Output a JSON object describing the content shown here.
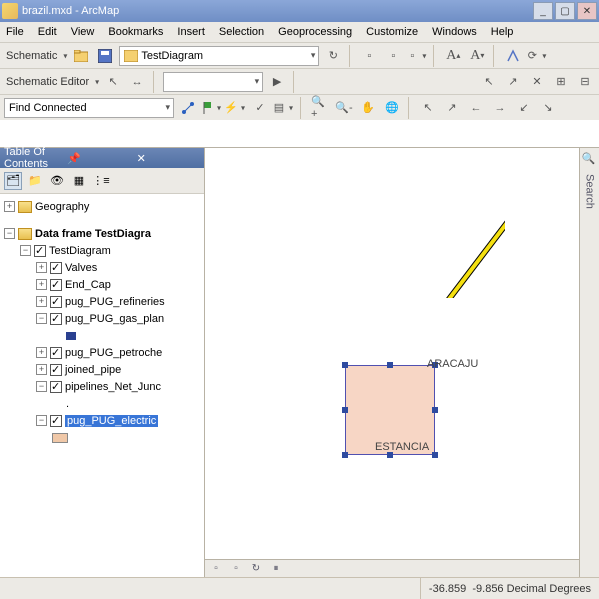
{
  "window": {
    "title": "brazil.mxd - ArcMap"
  },
  "menu": {
    "file": "File",
    "edit": "Edit",
    "view": "View",
    "bookmarks": "Bookmarks",
    "insert": "Insert",
    "selection": "Selection",
    "geoprocessing": "Geoprocessing",
    "customize": "Customize",
    "windows": "Windows",
    "help": "Help"
  },
  "tb1": {
    "schematic": "Schematic",
    "diagram": "TestDiagram"
  },
  "tb2": {
    "schematic_editor": "Schematic Editor"
  },
  "tb3": {
    "tool": "Find Connected"
  },
  "toc": {
    "header": "Table Of Contents",
    "root1": "Geography",
    "root2": "Data frame TestDiagra",
    "items": [
      {
        "label": "TestDiagram"
      },
      {
        "label": "Valves"
      },
      {
        "label": "End_Cap"
      },
      {
        "label": "pug_PUG_refineries"
      },
      {
        "label": "pug_PUG_gas_plan"
      },
      {
        "label": "pug_PUG_petroche"
      },
      {
        "label": "joined_pipe"
      },
      {
        "label": "pipelines_Net_Junc"
      },
      {
        "label": "."
      },
      {
        "label": "pug_PUG_electric"
      }
    ]
  },
  "map": {
    "label1": "ARACAJU",
    "label2": "ESTANCIA"
  },
  "sidedock": {
    "label": "Search"
  },
  "status": {
    "coords_x": "-36.859",
    "coords_y": "-9.856",
    "units": "Decimal Degrees"
  }
}
